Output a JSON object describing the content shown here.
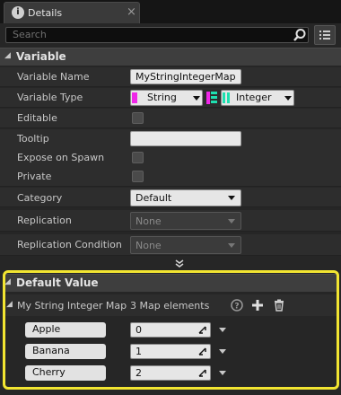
{
  "tab": {
    "title": "Details",
    "close": "×"
  },
  "search": {
    "placeholder": "Search"
  },
  "variable": {
    "header": "Variable",
    "rows": [
      {
        "label": "Variable Name",
        "value": "MyStringIntegerMap"
      },
      {
        "label": "Variable Type",
        "key_type": "String",
        "value_type": "Integer"
      },
      {
        "label": "Editable"
      },
      {
        "label": "Tooltip",
        "value": ""
      },
      {
        "label": "Expose on Spawn"
      },
      {
        "label": "Private"
      },
      {
        "label": "Category",
        "value": "Default"
      },
      {
        "label": "Replication",
        "value": "None"
      },
      {
        "label": "Replication Condition",
        "value": "None"
      }
    ]
  },
  "default_value": {
    "header": "Default Value",
    "map_label": "My String Integer Map",
    "element_count": "3 Map elements",
    "elements": [
      {
        "key": "Apple",
        "value": "0"
      },
      {
        "key": "Banana",
        "value": "1"
      },
      {
        "key": "Cherry",
        "value": "2"
      }
    ]
  },
  "colors": {
    "string_pin": "#f027e8",
    "integer_pin": "#1ee0b0",
    "highlight": "#f2e531"
  }
}
